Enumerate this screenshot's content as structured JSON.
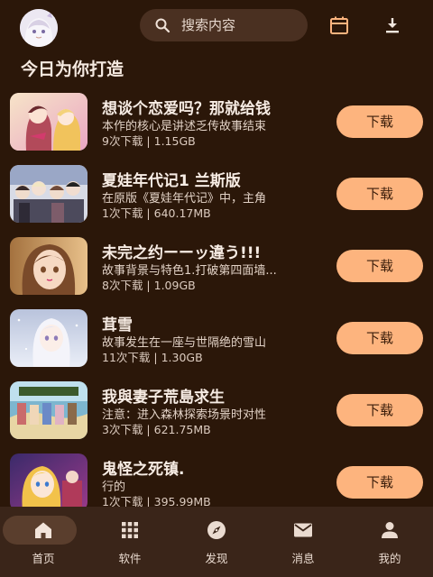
{
  "search": {
    "placeholder": "搜索内容"
  },
  "section": {
    "title": "今日为你打造"
  },
  "download_label": "下载",
  "items": [
    {
      "title": "想谈个恋爱吗？那就给钱",
      "desc": "本作的核心是讲述乏传故事结束",
      "meta": "9次下载 | 1.15GB"
    },
    {
      "title": "夏娃年代记1 兰斯版",
      "desc": "在原版《夏娃年代记》中，主角",
      "meta": "1次下载 | 640.17MB"
    },
    {
      "title": "未完之约ーーッ違う!!!",
      "desc": "故事背景与特色1.打破第四面墙...",
      "meta": "8次下载 | 1.09GB"
    },
    {
      "title": "茸雪",
      "desc": "故事发生在一座与世隔绝的雪山",
      "meta": "11次下载 | 1.30GB"
    },
    {
      "title": "我與妻子荒島求生",
      "desc": "注意：进入森林探索场景时对性",
      "meta": "3次下载 | 621.75MB"
    },
    {
      "title": "鬼怪之死镇.",
      "desc": "行的",
      "meta": "1次下载 | 395.99MB"
    }
  ],
  "nav": [
    {
      "label": "首页",
      "icon": "home-icon",
      "active": true
    },
    {
      "label": "软件",
      "icon": "grid-icon",
      "active": false
    },
    {
      "label": "发现",
      "icon": "compass-icon",
      "active": false
    },
    {
      "label": "消息",
      "icon": "mail-icon",
      "active": false
    },
    {
      "label": "我的",
      "icon": "person-icon",
      "active": false
    }
  ],
  "colors": {
    "background": "#2b1709",
    "accent": "#fdb47e",
    "nav_bg": "#3a2519",
    "search_bg": "#4a3021"
  }
}
